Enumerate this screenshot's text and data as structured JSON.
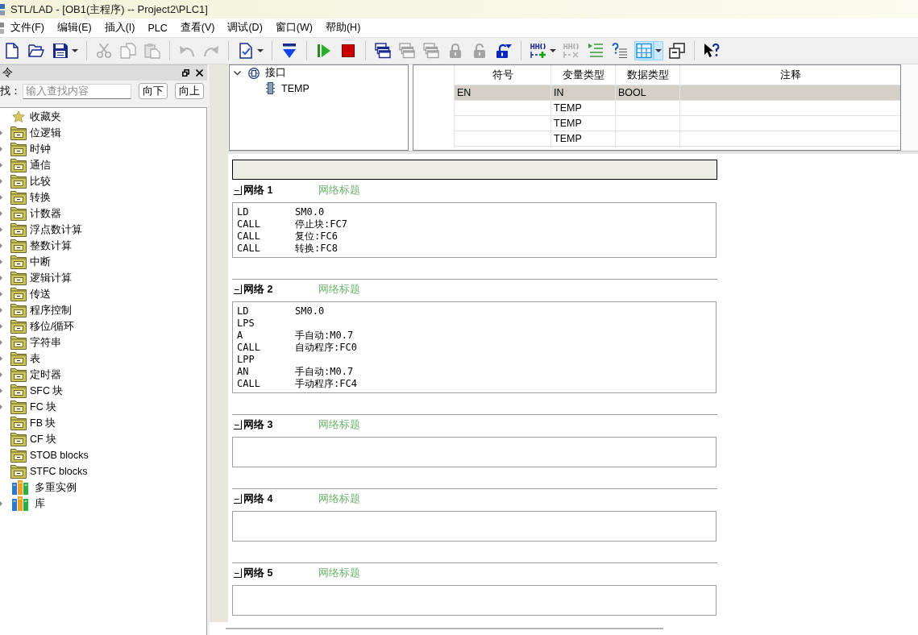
{
  "window": {
    "title": "STL/LAD - [OB1(主程序) -- Project2\\PLC1]"
  },
  "menu": [
    "文件(F)",
    "编辑(E)",
    "插入(I)",
    "PLC",
    "查看(V)",
    "调试(D)",
    "窗口(W)",
    "帮助(H)"
  ],
  "toolbar": [
    {
      "buttons": [
        {
          "disabled": false,
          "pressed": false,
          "dropdown": false
        },
        {
          "disabled": false,
          "pressed": false,
          "dropdown": false
        },
        {
          "disabled": false,
          "pressed": false,
          "dropdown": true
        }
      ]
    },
    {
      "buttons": [
        {
          "disabled": true,
          "pressed": false,
          "dropdown": false
        },
        {
          "disabled": true,
          "pressed": false,
          "dropdown": false
        },
        {
          "disabled": true,
          "pressed": false,
          "dropdown": false
        }
      ]
    },
    {
      "buttons": [
        {
          "disabled": true,
          "pressed": false,
          "dropdown": false
        },
        {
          "disabled": true,
          "pressed": false,
          "dropdown": false
        }
      ]
    },
    {
      "buttons": [
        {
          "disabled": false,
          "pressed": false,
          "dropdown": true
        }
      ]
    },
    {
      "buttons": [
        {
          "disabled": false,
          "pressed": false,
          "dropdown": false
        }
      ]
    },
    {
      "buttons": [
        {
          "disabled": false,
          "pressed": false,
          "dropdown": false
        },
        {
          "disabled": false,
          "pressed": false,
          "dropdown": false
        }
      ]
    },
    {
      "buttons": [
        {
          "disabled": false,
          "pressed": false,
          "dropdown": false
        },
        {
          "disabled": true,
          "pressed": false,
          "dropdown": false
        },
        {
          "disabled": true,
          "pressed": false,
          "dropdown": false
        },
        {
          "disabled": true,
          "pressed": false,
          "dropdown": false
        },
        {
          "disabled": true,
          "pressed": false,
          "dropdown": false
        },
        {
          "disabled": false,
          "pressed": false,
          "dropdown": false
        }
      ]
    },
    {
      "buttons": [
        {
          "disabled": false,
          "pressed": false,
          "dropdown": true
        },
        {
          "disabled": true,
          "pressed": false,
          "dropdown": false
        },
        {
          "disabled": false,
          "pressed": false,
          "dropdown": false
        },
        {
          "disabled": false,
          "pressed": false,
          "dropdown": false
        },
        {
          "disabled": false,
          "pressed": true,
          "dropdown": true
        },
        {
          "disabled": false,
          "pressed": false,
          "dropdown": false
        }
      ]
    },
    {
      "buttons": [
        {
          "disabled": false,
          "pressed": false,
          "dropdown": false
        }
      ]
    }
  ],
  "instructions_panel": {
    "title": "令",
    "search": {
      "label": "找：",
      "placeholder": "输入查找内容"
    },
    "buttons": [
      "向下",
      "向上"
    ],
    "items": [
      {
        "kind": "favorites",
        "label": "收藏夹",
        "expandable": false
      },
      {
        "kind": "folder",
        "label": "位逻辑",
        "expandable": true
      },
      {
        "kind": "folder",
        "label": "时钟",
        "expandable": true
      },
      {
        "kind": "folder",
        "label": "通信",
        "expandable": true
      },
      {
        "kind": "folder",
        "label": "比较",
        "expandable": true
      },
      {
        "kind": "folder",
        "label": "转换",
        "expandable": true
      },
      {
        "kind": "folder",
        "label": "计数器",
        "expandable": true
      },
      {
        "kind": "folder",
        "label": "浮点数计算",
        "expandable": true
      },
      {
        "kind": "folder",
        "label": "整数计算",
        "expandable": true
      },
      {
        "kind": "folder",
        "label": "中断",
        "expandable": true
      },
      {
        "kind": "folder",
        "label": "逻辑计算",
        "expandable": true
      },
      {
        "kind": "folder",
        "label": "传送",
        "expandable": true
      },
      {
        "kind": "folder",
        "label": "程序控制",
        "expandable": true
      },
      {
        "kind": "folder",
        "label": "移位/循环",
        "expandable": true
      },
      {
        "kind": "folder",
        "label": "字符串",
        "expandable": true
      },
      {
        "kind": "folder",
        "label": "表",
        "expandable": true
      },
      {
        "kind": "folder",
        "label": "定时器",
        "expandable": true
      },
      {
        "kind": "folder",
        "label": "SFC 块",
        "expandable": true
      },
      {
        "kind": "folder",
        "label": "FC 块",
        "expandable": true
      },
      {
        "kind": "folder",
        "label": "FB 块",
        "expandable": false
      },
      {
        "kind": "folder",
        "label": "CF 块",
        "expandable": false
      },
      {
        "kind": "folder",
        "label": "STOB blocks",
        "expandable": false
      },
      {
        "kind": "folder",
        "label": "STFC blocks",
        "expandable": false
      },
      {
        "kind": "library",
        "label": "多重实例",
        "expandable": false
      },
      {
        "kind": "library",
        "label": "库",
        "expandable": true
      }
    ]
  },
  "interface_tree": {
    "label": "接口",
    "expanded": true,
    "children": [
      {
        "label": "TEMP"
      }
    ]
  },
  "variable_table": {
    "columns": [
      "符号",
      "变量类型",
      "数据类型",
      "注释"
    ],
    "rows": [
      {
        "symbol": "EN",
        "variable_type": "IN",
        "data_type": "BOOL",
        "selected": true
      },
      {
        "variable_type": "TEMP",
        "selected": false
      },
      {
        "variable_type": "TEMP",
        "selected": false
      },
      {
        "variable_type": "TEMP",
        "selected": false
      }
    ]
  },
  "editor": {
    "networks": [
      {
        "header": "网络 1",
        "title": "网络标题",
        "expanded": true,
        "lines": [
          {
            "instruction": "LD",
            "operand": "SM0.0"
          },
          {
            "instruction": "CALL",
            "operand": "停止块:FC7"
          },
          {
            "instruction": "CALL",
            "operand": "复位:FC6"
          },
          {
            "instruction": "CALL",
            "operand": "转换:FC8"
          }
        ]
      },
      {
        "header": "网络 2",
        "title": "网络标题",
        "expanded": true,
        "lines": [
          {
            "instruction": "LD",
            "operand": "SM0.0"
          },
          {
            "instruction": "LPS"
          },
          {
            "instruction": "A",
            "operand": "手自动:M0.7"
          },
          {
            "instruction": "CALL",
            "operand": "自动程序:FC0"
          },
          {
            "instruction": "LPP"
          },
          {
            "instruction": "AN",
            "operand": "手自动:M0.7"
          },
          {
            "instruction": "CALL",
            "operand": "手动程序:FC4"
          }
        ]
      },
      {
        "header": "网络 3",
        "title": "网络标题",
        "expanded": true
      },
      {
        "header": "网络 4",
        "title": "网络标题",
        "expanded": true
      },
      {
        "header": "网络 5",
        "title": "网络标题",
        "expanded": true
      }
    ]
  }
}
